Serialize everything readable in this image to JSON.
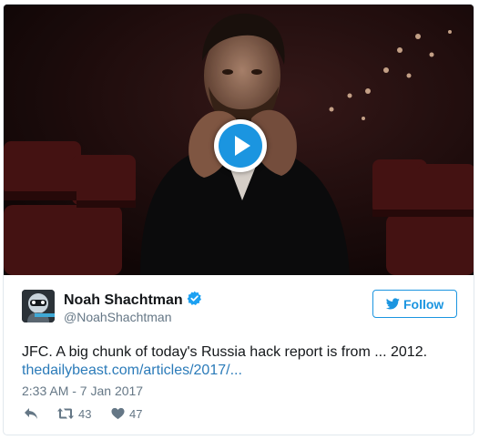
{
  "media": {
    "kind": "video thumbnail",
    "play_icon": "play-icon"
  },
  "tweet": {
    "author_name": "Noah Shachtman",
    "author_handle": "@NoahShachtman",
    "verified_icon": "verified-badge-icon",
    "follow_label": "Follow",
    "follow_icon": "twitter-bird-icon",
    "text": "JFC. A big chunk of today's Russia hack report is from ... 2012.",
    "link_text": "thedailybeast.com/articles/2017/...",
    "timestamp": "2:33 AM - 7 Jan 2017",
    "retweet_count": "43",
    "like_count": "47",
    "icons": {
      "reply": "reply-icon",
      "retweet": "retweet-icon",
      "like": "heart-icon"
    }
  },
  "colors": {
    "accent": "#1b95e0",
    "link": "#2b7bb9",
    "muted": "#657786",
    "text": "#14171a",
    "border": "#e1e8ed"
  }
}
